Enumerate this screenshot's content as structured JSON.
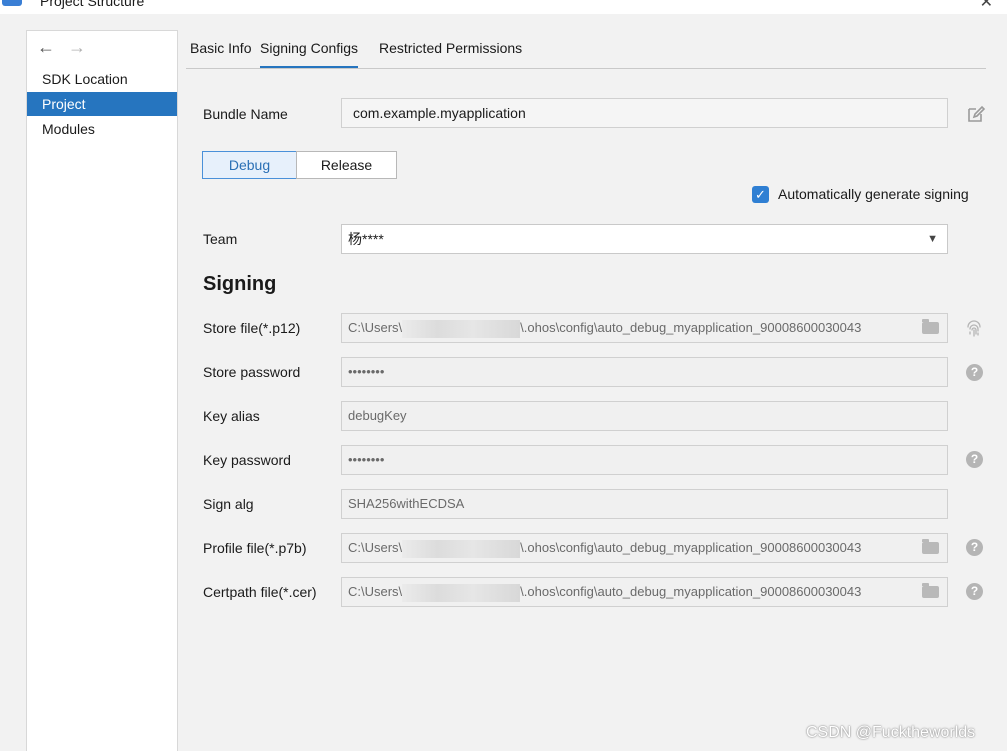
{
  "window": {
    "title": "Project Structure",
    "close_glyph": "✕"
  },
  "nav": {
    "back_glyph": "←",
    "forward_glyph": "→"
  },
  "sidebar": {
    "items": [
      {
        "label": "SDK Location",
        "selected": false
      },
      {
        "label": "Project",
        "selected": true
      },
      {
        "label": "Modules",
        "selected": false
      }
    ]
  },
  "tabs": [
    {
      "label": "Basic Info",
      "active": false
    },
    {
      "label": "Signing Configs",
      "active": true
    },
    {
      "label": "Restricted Permissions",
      "active": false
    }
  ],
  "bundle": {
    "label": "Bundle Name",
    "value": "com.example.myapplication"
  },
  "build_type": {
    "debug_label": "Debug",
    "release_label": "Release",
    "selected": "Debug"
  },
  "auto_sign": {
    "label": "Automatically generate signing",
    "checked": true
  },
  "team": {
    "label": "Team",
    "value": "杨****"
  },
  "signing": {
    "heading": "Signing",
    "store_file": {
      "label": "Store file(*.p12)",
      "path_prefix": "C:\\Users\\",
      "path_suffix": "\\.ohos\\config\\auto_debug_myapplication_90008600030043"
    },
    "store_password": {
      "label": "Store password",
      "value": "••••••••"
    },
    "key_alias": {
      "label": "Key alias",
      "value": "debugKey"
    },
    "key_password": {
      "label": "Key password",
      "value": "••••••••"
    },
    "sign_alg": {
      "label": "Sign alg",
      "value": "SHA256withECDSA"
    },
    "profile_file": {
      "label": "Profile file(*.p7b)",
      "path_prefix": "C:\\Users\\",
      "path_suffix": "\\.ohos\\config\\auto_debug_myapplication_90008600030043"
    },
    "certpath_file": {
      "label": "Certpath file(*.cer)",
      "path_prefix": "C:\\Users\\",
      "path_suffix": "\\.ohos\\config\\auto_debug_myapplication_90008600030043"
    }
  },
  "icons": {
    "edit": "edit-icon",
    "fingerprint": "fingerprint-icon",
    "help": "help-icon",
    "folder": "folder-icon",
    "help_glyph": "?",
    "check_glyph": "✓",
    "dropdown_glyph": "▼"
  },
  "colors": {
    "accent": "#2675bf",
    "selected_bg": "#2675bf",
    "checkbox": "#2f7fd3"
  },
  "watermark": "CSDN @Fucktheworlds"
}
